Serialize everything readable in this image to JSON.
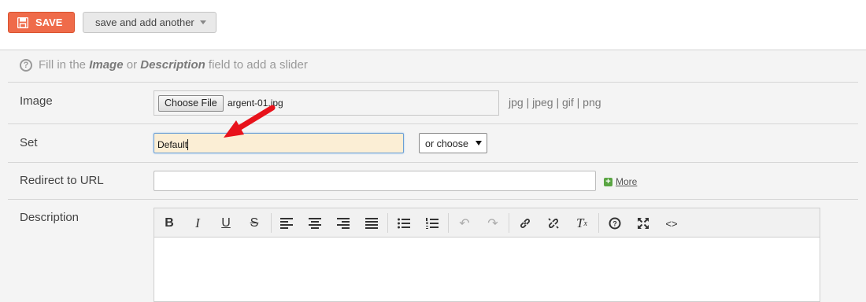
{
  "toolbar": {
    "save_label": "SAVE",
    "save_add_label": "save and add another",
    "save_color": "#ef6b4a"
  },
  "help": {
    "prefix": "Fill in the ",
    "field1": "Image",
    "middle": " or ",
    "field2": "Description",
    "suffix": " field to add a slider"
  },
  "form": {
    "image": {
      "label": "Image",
      "button": "Choose File",
      "filename": "argent-01.jpg",
      "types": "jpg | jpeg | gif | png"
    },
    "set": {
      "label": "Set",
      "value": "Default",
      "choose": "or choose"
    },
    "url": {
      "label": "Redirect to URL",
      "value": "",
      "more": "More"
    },
    "description": {
      "label": "Description",
      "toolbar_icons": [
        "bold-icon",
        "italic-icon",
        "underline-icon",
        "strikethrough-icon",
        "align-left-icon",
        "align-center-icon",
        "align-right-icon",
        "align-justify-icon",
        "bulleted-list-icon",
        "numbered-list-icon",
        "undo-icon",
        "redo-icon",
        "link-icon",
        "unlink-icon",
        "clear-format-icon",
        "help-icon",
        "fullscreen-icon",
        "source-code-icon"
      ]
    }
  }
}
